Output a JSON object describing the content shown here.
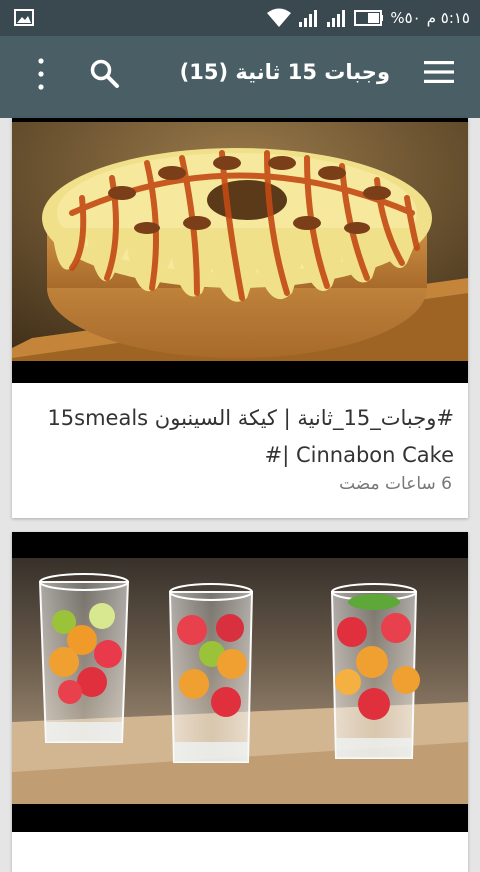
{
  "status_bar": {
    "time": "٥:١٥ م",
    "battery": "%٥٠"
  },
  "app_bar": {
    "title": "وجبات 15 ثانية (15)",
    "menu_icon": "hamburger-menu-icon",
    "search_icon": "search-icon",
    "more_icon": "more-vert-icon"
  },
  "cards": [
    {
      "title": "#وجبات_15_ثانية | كيكة السينبون 15smeals #| Cinnabon Cake",
      "time": "6 ساعات مضت",
      "image": "cinnamon-cake-thumbnail"
    },
    {
      "title": "",
      "time": "",
      "image": "fruit-drink-glasses-thumbnail"
    }
  ],
  "colors": {
    "status_bar": "#39494f",
    "app_bar": "#4a5e66",
    "background": "#e5e5e5"
  }
}
